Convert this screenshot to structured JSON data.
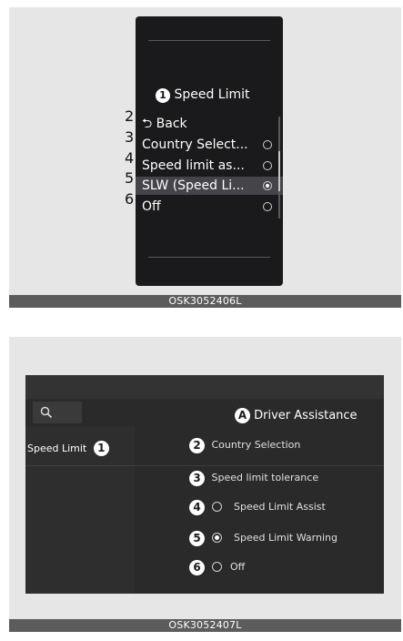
{
  "figure1": {
    "caption": "OSK3052406L",
    "title": "Speed Limit",
    "title_badge": "1",
    "items": [
      {
        "callout": "2",
        "label": "⮌ Back",
        "radio": null
      },
      {
        "callout": "3",
        "label": "Country Select...",
        "radio": "off"
      },
      {
        "callout": "4",
        "label": "Speed limit as...",
        "radio": "off"
      },
      {
        "callout": "5",
        "label": "SLW (Speed Li...",
        "radio": "on"
      },
      {
        "callout": "6",
        "label": "Off",
        "radio": "off"
      }
    ]
  },
  "figure2": {
    "caption": "OSK3052407L",
    "search_icon": "search-icon",
    "title_badge": "A",
    "title": "Driver Assistance",
    "left_label": "Speed Limit",
    "left_badge": "1",
    "items": [
      {
        "callout": "2",
        "label": "Country Selection",
        "radio": null
      },
      {
        "callout": "3",
        "label": "Speed limit tolerance",
        "radio": null
      },
      {
        "callout": "4",
        "label": "Speed Limit Assist",
        "radio": "off"
      },
      {
        "callout": "5",
        "label": "Speed Limit Warning",
        "radio": "on"
      },
      {
        "callout": "6",
        "label": "Off",
        "radio": "off"
      }
    ]
  }
}
